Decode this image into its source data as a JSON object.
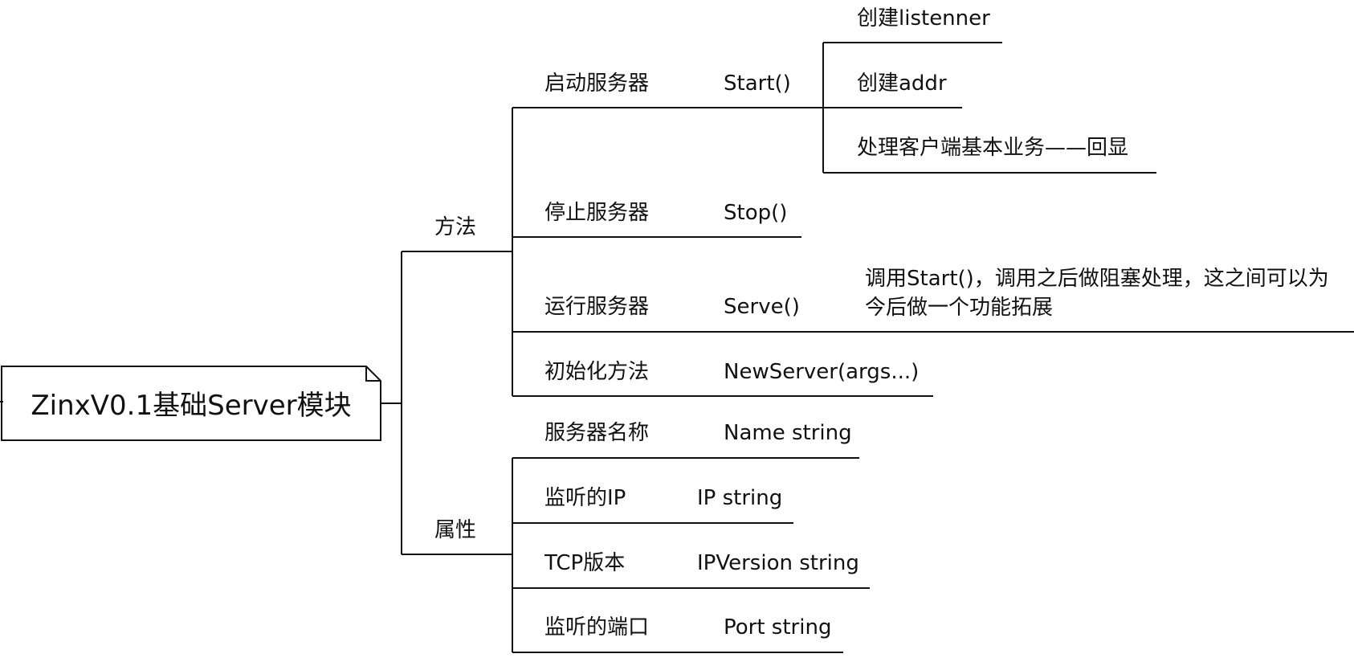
{
  "root": {
    "title": "ZinxV0.1基础Server模块"
  },
  "branches": {
    "methods": {
      "label": "方法",
      "start": {
        "label": "启动服务器",
        "func": "Start()",
        "children": [
          "创建listenner",
          "创建addr",
          "处理客户端基本业务——回显"
        ]
      },
      "stop": {
        "label": "停止服务器",
        "func": "Stop()"
      },
      "serve": {
        "label": "运行服务器",
        "func": "Serve()",
        "note": "调用Start()，调用之后做阻塞处理，这之间可以为今后做一个功能拓展"
      },
      "init": {
        "label": "初始化方法",
        "func": "NewServer(args...)"
      }
    },
    "attributes": {
      "label": "属性",
      "name": {
        "label": "服务器名称",
        "type": "Name string"
      },
      "ip": {
        "label": "监听的IP",
        "type": "IP string"
      },
      "tcp": {
        "label": "TCP版本",
        "type": "IPVersion string"
      },
      "port": {
        "label": "监听的端口",
        "type": "Port string"
      }
    }
  }
}
